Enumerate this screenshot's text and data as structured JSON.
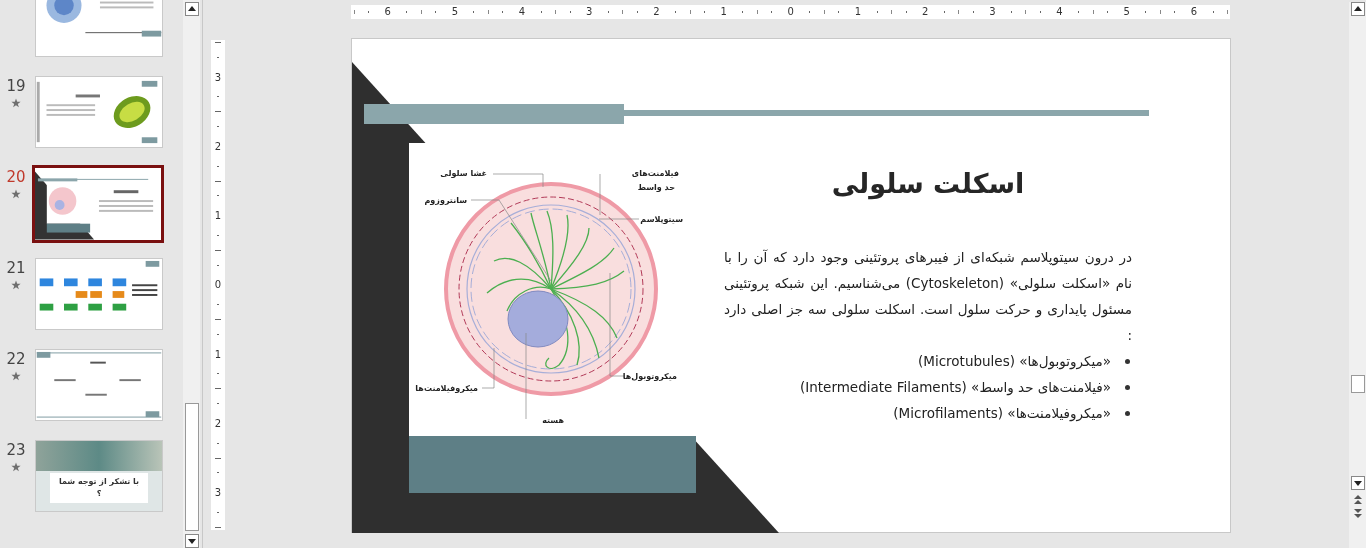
{
  "thumbnails": [
    {
      "kind": "cell",
      "selected": false
    },
    {
      "number": "19",
      "kind": "mitochondrion",
      "selected": false
    },
    {
      "number": "20",
      "kind": "cytoskeleton",
      "selected": true
    },
    {
      "number": "21",
      "kind": "diagram",
      "selected": false
    },
    {
      "number": "22",
      "kind": "sources",
      "selected": false
    },
    {
      "number": "23",
      "kind": "closing",
      "selected": false,
      "lines": [
        "با تشکر از توجه شما",
        "؟"
      ]
    }
  ],
  "horizontal_ruler": [
    "6",
    "5",
    "4",
    "3",
    "2",
    "1",
    "0",
    "1",
    "2",
    "3",
    "4",
    "5",
    "6"
  ],
  "vertical_ruler": [
    "3",
    "2",
    "1",
    "0",
    "1",
    "2",
    "3"
  ],
  "slide": {
    "title": "اسکلت سلولی",
    "paragraph": "در درون سیتوپلاسم شبکه‌ای از فیبرهای پروتئینی وجود دارد که آن را با نام «اسکلت سلولی» (Cytoskeleton) می‌شناسیم. این شبکه پروتئینی مسئول پایداری و حرکت سلول است. اسکلت سلولی سه جز اصلی دارد :",
    "bullets": [
      "«میکروتوبول‌ها» (Microtubules)",
      "«فیلامنت‌های حد واسط» (Intermediate Filaments)",
      "«میکروفیلامنت‌ها» (Microfilaments)"
    ],
    "diagram_labels": {
      "cell_membrane": "غشا سلولی",
      "intermediate_filaments": [
        "فیلامنت‌های",
        "حد واسط"
      ],
      "centrosome": "سانتروزوم",
      "cytoplasm": "سیتوپلاسم",
      "microtubules": "میکروتوبول‌ها",
      "microfilaments": "میکروفیلامنت‌ها",
      "nucleus": "هسته"
    }
  }
}
